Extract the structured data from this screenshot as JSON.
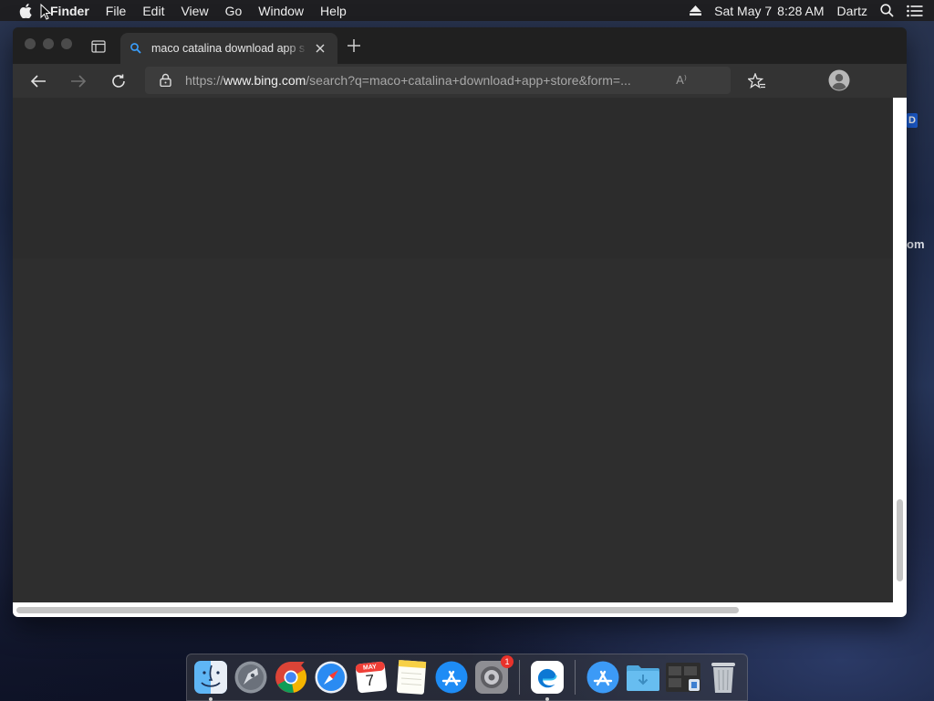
{
  "menubar": {
    "app_name": "Finder",
    "menus": [
      "File",
      "Edit",
      "View",
      "Go",
      "Window",
      "Help"
    ],
    "date": "Sat May 7",
    "time": "8:28 AM",
    "user": "Dartz"
  },
  "browser": {
    "tab_title": "maco catalina download app s",
    "url_prefix": "https://",
    "url_domain": "www.bing.com",
    "url_rest": "/search?q=maco+catalina+download+app+store&form=...",
    "read_aloud_glyph": "A⁾"
  },
  "desktop": {
    "badge_letter": "D",
    "peek_text": "om"
  },
  "dock": {
    "apps": [
      "Finder",
      "Launchpad",
      "Google Chrome",
      "Safari",
      "Calendar",
      "Notes",
      "App Store",
      "System Preferences",
      "Microsoft Edge",
      "Applications",
      "Downloads",
      "Screen Recording",
      "Trash"
    ],
    "calendar_month": "MAY",
    "calendar_day": "7",
    "system_prefs_badge": "1"
  },
  "colors": {
    "menubar_bg": "#1f1f22",
    "window_bg": "#2b2b2b",
    "tab_bg": "#333333",
    "address_bg": "#3c3c3c",
    "accent_blue": "#1d5fd6"
  }
}
